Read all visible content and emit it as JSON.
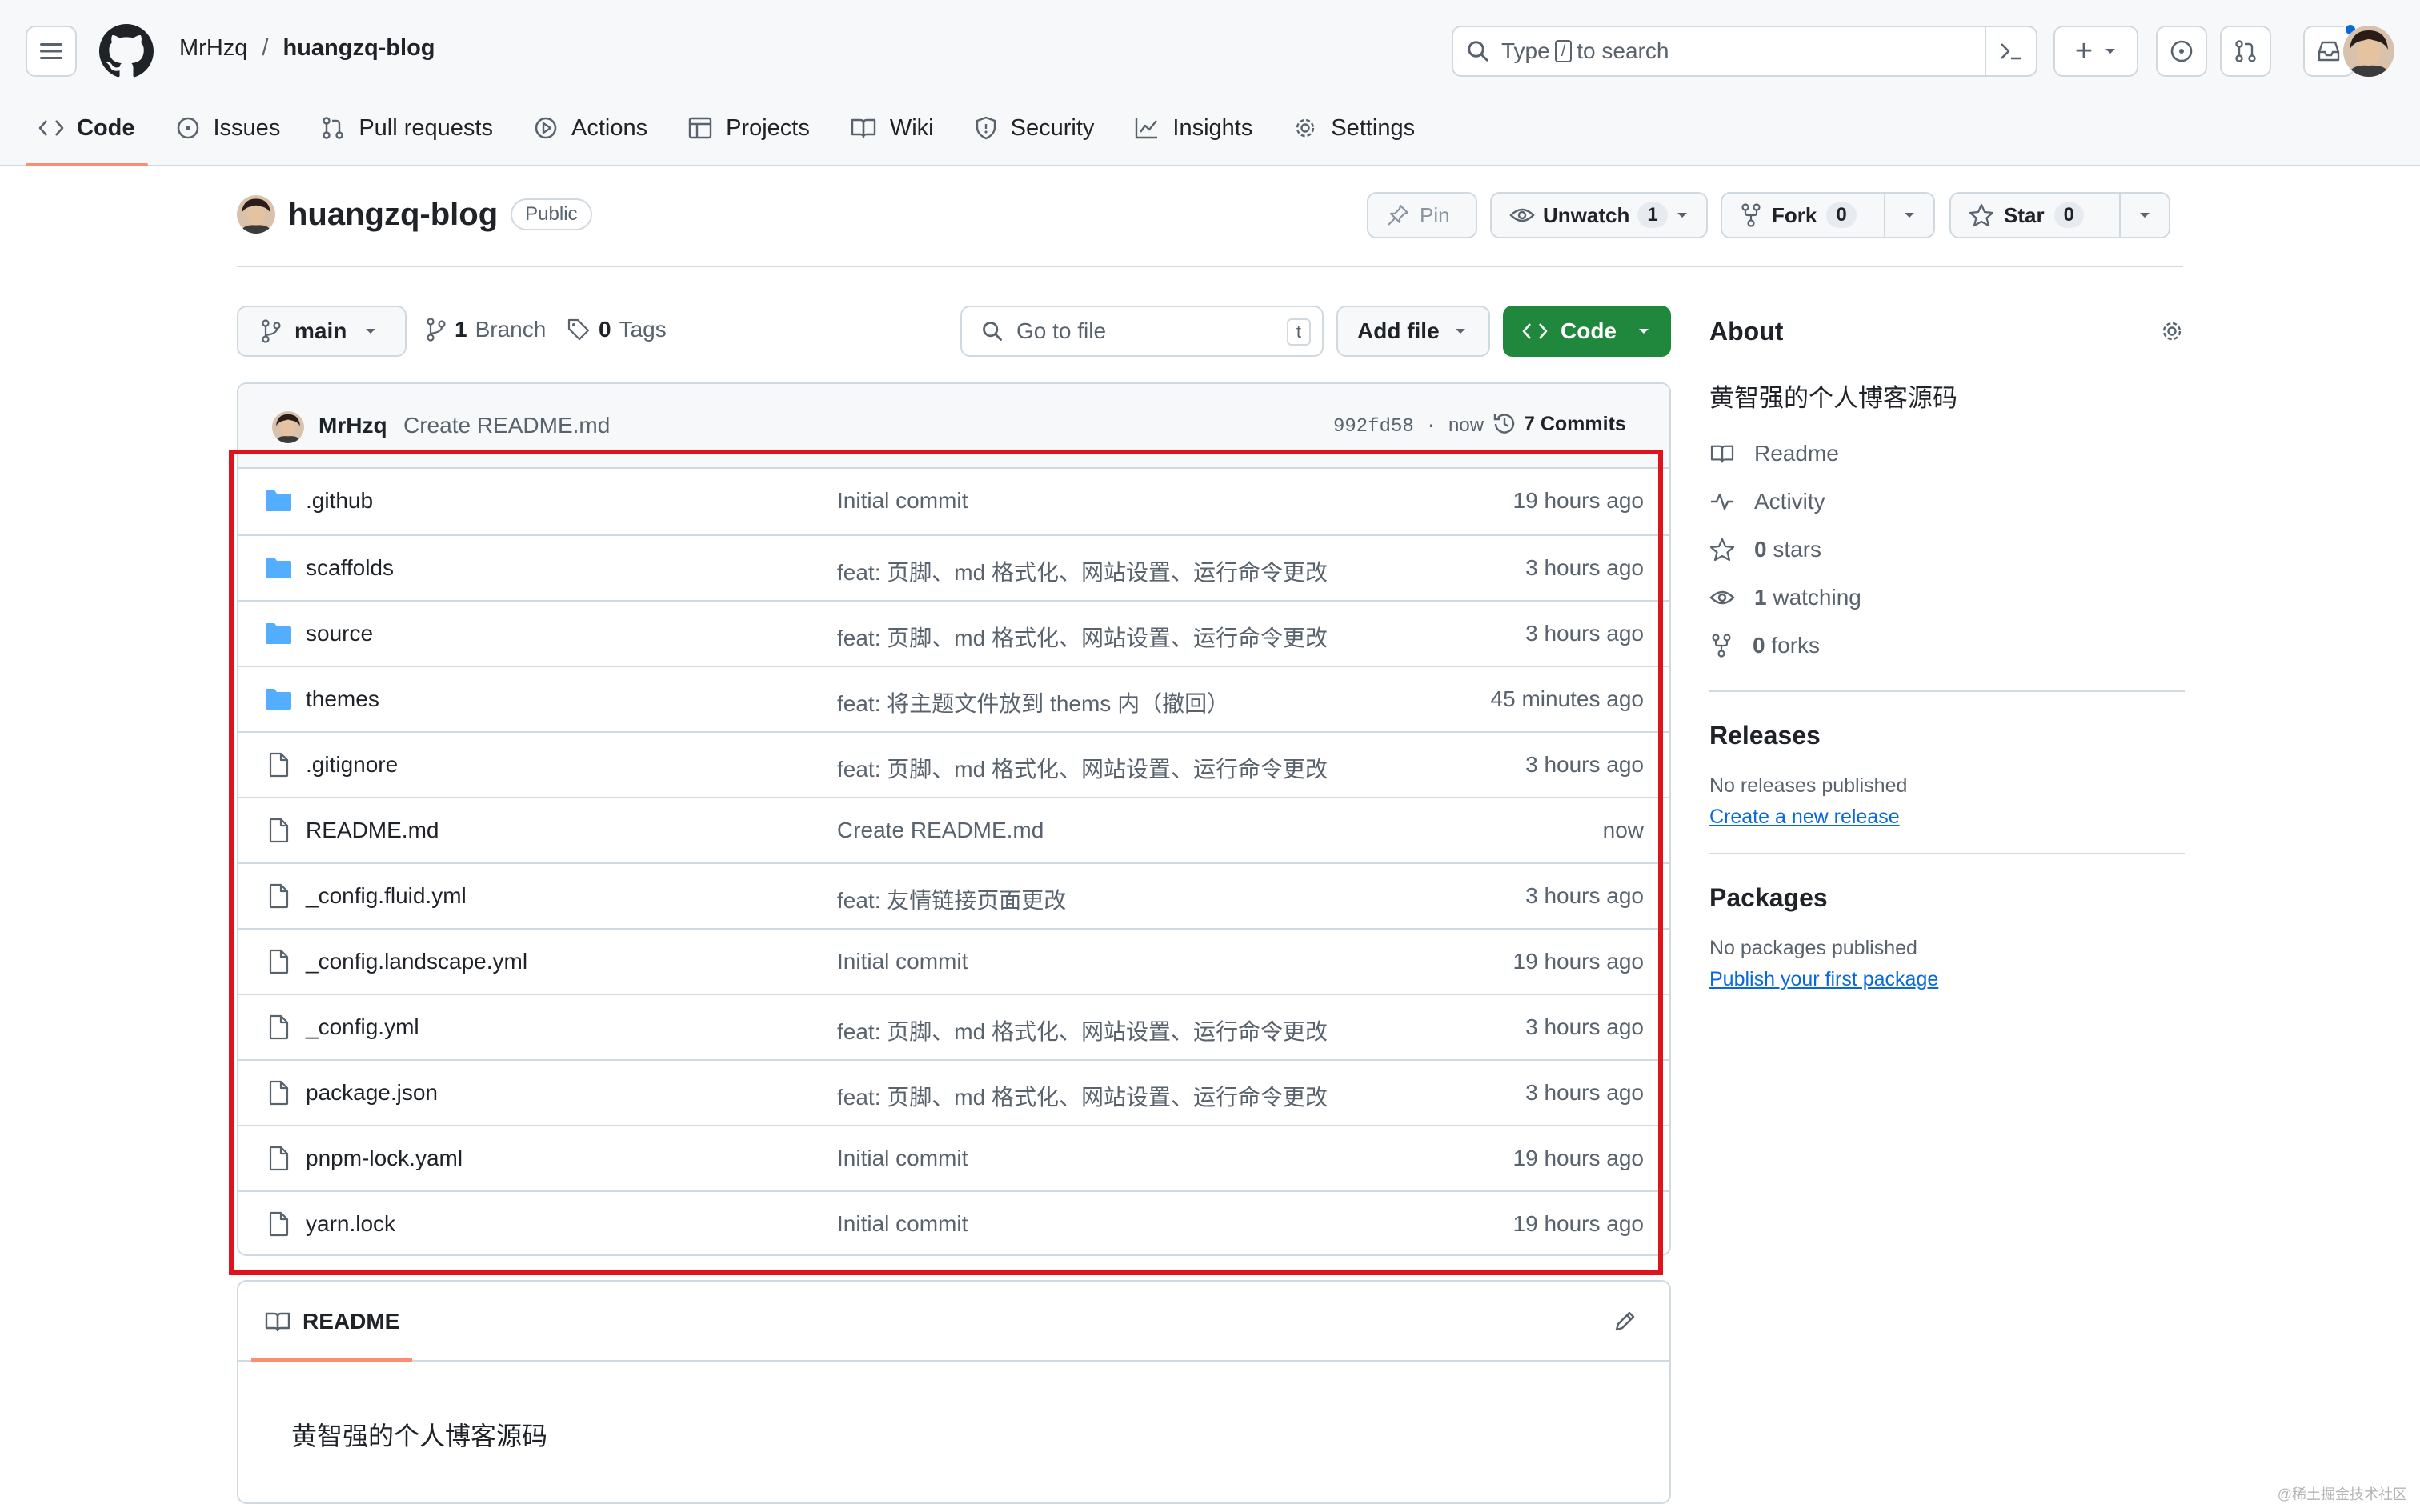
{
  "header": {
    "owner": "MrHzq",
    "separator": "/",
    "repo": "huangzq-blog",
    "search_prefix": "Type",
    "search_key": "/",
    "search_suffix": "to search",
    "plus_label": "+"
  },
  "tabs": [
    {
      "label": "Code",
      "icon": "code-icon",
      "active": true
    },
    {
      "label": "Issues",
      "icon": "issue-icon"
    },
    {
      "label": "Pull requests",
      "icon": "pull-request-icon"
    },
    {
      "label": "Actions",
      "icon": "play-icon"
    },
    {
      "label": "Projects",
      "icon": "table-icon"
    },
    {
      "label": "Wiki",
      "icon": "book-icon"
    },
    {
      "label": "Security",
      "icon": "shield-icon"
    },
    {
      "label": "Insights",
      "icon": "graph-icon"
    },
    {
      "label": "Settings",
      "icon": "gear-icon"
    }
  ],
  "repo_header": {
    "name": "huangzq-blog",
    "visibility": "Public",
    "pin": "Pin",
    "unwatch": "Unwatch",
    "watch_count": "1",
    "fork": "Fork",
    "fork_count": "0",
    "star": "Star",
    "star_count": "0"
  },
  "file_nav": {
    "branch": "main",
    "branch_count": "1",
    "branch_label": "Branch",
    "tag_count": "0",
    "tag_label": "Tags",
    "goto_placeholder": "Go to file",
    "goto_key": "t",
    "add_file": "Add file",
    "code": "Code"
  },
  "latest_commit": {
    "author": "MrHzq",
    "message": "Create README.md",
    "sha": "992fd58",
    "time_sep": "·",
    "time": "now",
    "commits": "7 Commits"
  },
  "files": [
    {
      "name": ".github",
      "type": "dir",
      "message": "Initial commit",
      "time": "19 hours ago"
    },
    {
      "name": "scaffolds",
      "type": "dir",
      "message": "feat: 页脚、md 格式化、网站设置、运行命令更改",
      "time": "3 hours ago"
    },
    {
      "name": "source",
      "type": "dir",
      "message": "feat: 页脚、md 格式化、网站设置、运行命令更改",
      "time": "3 hours ago"
    },
    {
      "name": "themes",
      "type": "dir",
      "message": "feat: 将主题文件放到 thems 内（撤回）",
      "time": "45 minutes ago"
    },
    {
      "name": ".gitignore",
      "type": "file",
      "message": "feat: 页脚、md 格式化、网站设置、运行命令更改",
      "time": "3 hours ago"
    },
    {
      "name": "README.md",
      "type": "file",
      "message": "Create README.md",
      "time": "now"
    },
    {
      "name": "_config.fluid.yml",
      "type": "file",
      "message": "feat: 友情链接页面更改",
      "time": "3 hours ago"
    },
    {
      "name": "_config.landscape.yml",
      "type": "file",
      "message": "Initial commit",
      "time": "19 hours ago"
    },
    {
      "name": "_config.yml",
      "type": "file",
      "message": "feat: 页脚、md 格式化、网站设置、运行命令更改",
      "time": "3 hours ago"
    },
    {
      "name": "package.json",
      "type": "file",
      "message": "feat: 页脚、md 格式化、网站设置、运行命令更改",
      "time": "3 hours ago"
    },
    {
      "name": "pnpm-lock.yaml",
      "type": "file",
      "message": "Initial commit",
      "time": "19 hours ago"
    },
    {
      "name": "yarn.lock",
      "type": "file",
      "message": "Initial commit",
      "time": "19 hours ago"
    }
  ],
  "readme": {
    "tab": "README",
    "content": "黄智强的个人博客源码"
  },
  "sidebar": {
    "about_title": "About",
    "description": "黄智强的个人博客源码",
    "readme": "Readme",
    "activity": "Activity",
    "stars_count": "0",
    "stars_label": "stars",
    "watching_count": "1",
    "watching_label": "watching",
    "forks_count": "0",
    "forks_label": "forks",
    "releases_title": "Releases",
    "releases_empty": "No releases published",
    "releases_link": "Create a new release",
    "packages_title": "Packages",
    "packages_empty": "No packages published",
    "packages_link": "Publish your first package"
  },
  "watermark": "@稀土掘金技术社区",
  "colors": {
    "accent_green": "#1f883d",
    "tab_underline": "#fd8c73",
    "folder_blue": "#54aeff",
    "link_blue": "#0969da",
    "highlight_red": "#e0131c"
  }
}
